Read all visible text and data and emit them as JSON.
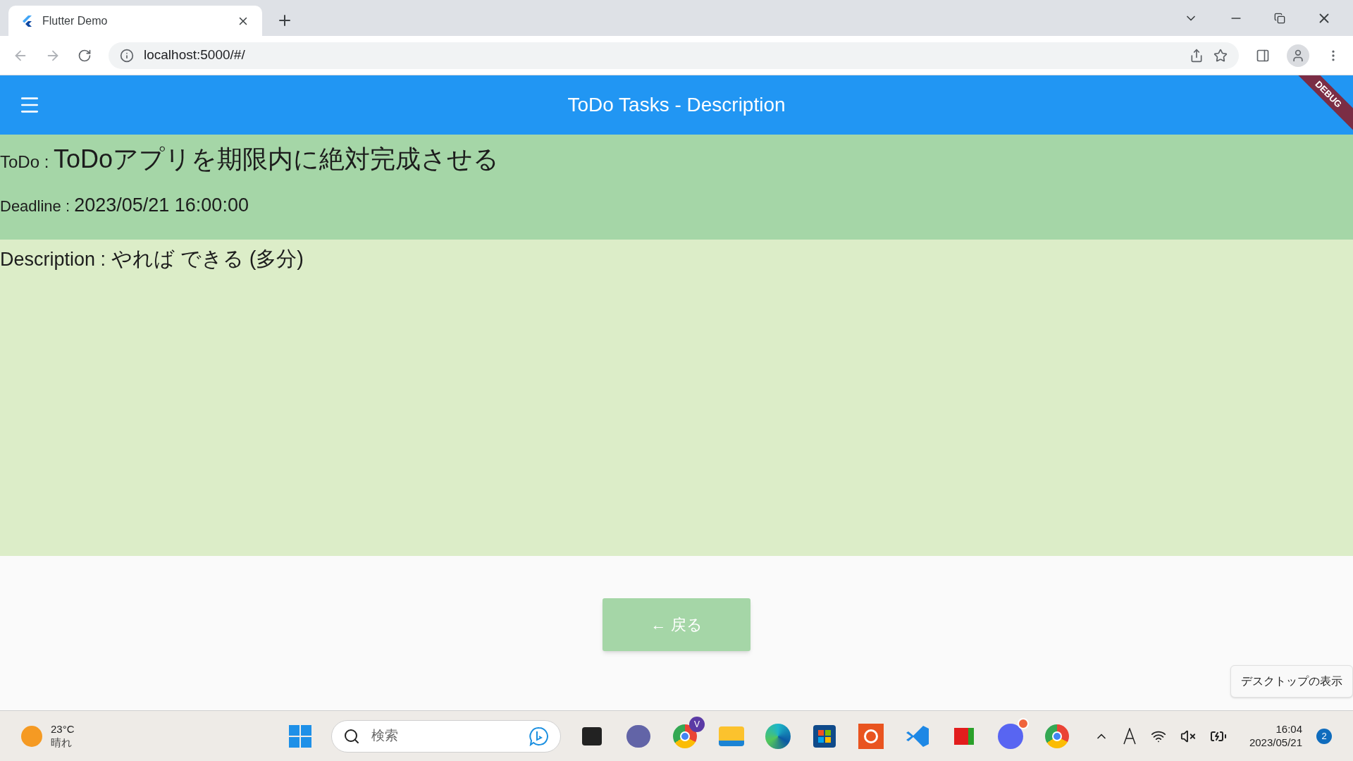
{
  "browser": {
    "tab_title": "Flutter Demo",
    "url": "localhost:5000/#/"
  },
  "app_bar": {
    "title": "ToDo Tasks - Description",
    "debug_banner": "DEBUG"
  },
  "todo": {
    "label": "ToDo : ",
    "value": "ToDoアプリを期限内に絶対完成させる"
  },
  "deadline": {
    "label": "Deadline : ",
    "value": "2023/05/21 16:00:00"
  },
  "description": {
    "label": "Description : ",
    "value": "やれば できる (多分)"
  },
  "back_button": "← 戻る",
  "tooltip": "デスクトップの表示",
  "taskbar": {
    "weather_temp": "23°C",
    "weather_condition": "晴れ",
    "search_placeholder": "検索",
    "profile_badge": "V",
    "time": "16:04",
    "date": "2023/05/21",
    "notification_count": "2"
  }
}
